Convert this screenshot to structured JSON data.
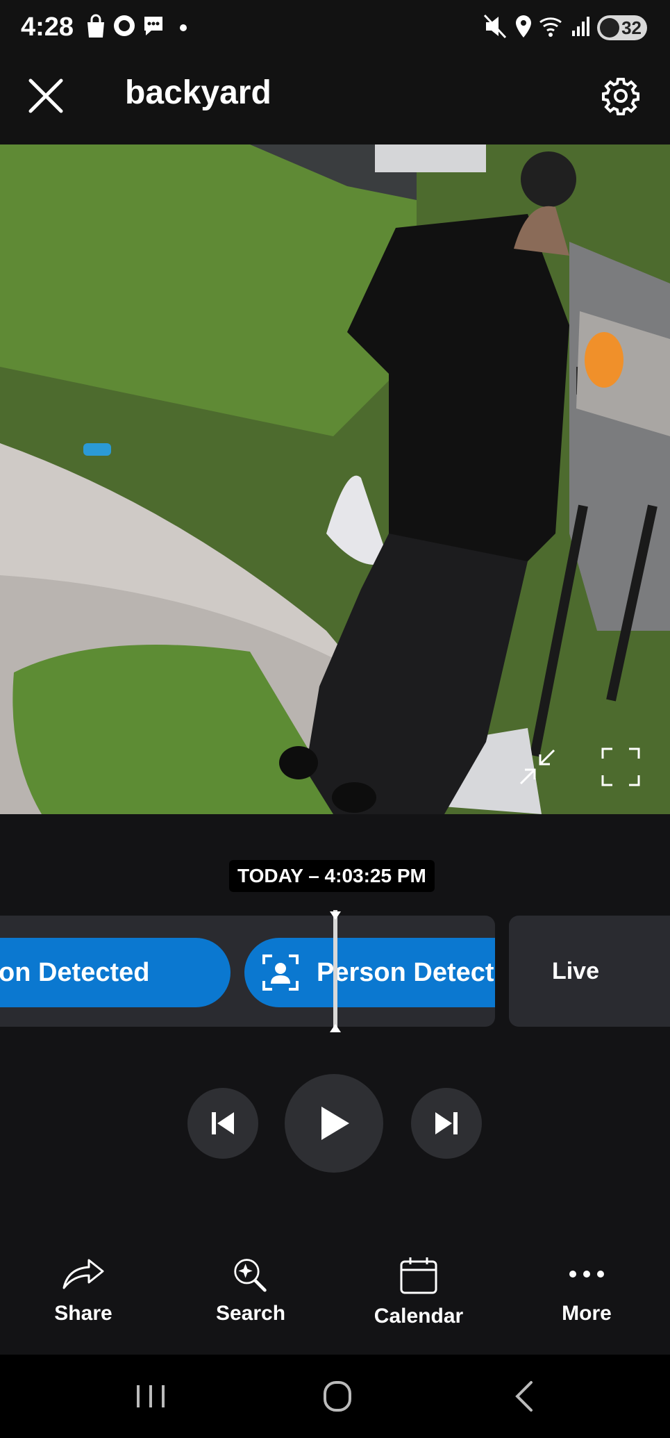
{
  "status_bar": {
    "time": "4:28",
    "battery": "32"
  },
  "header": {
    "title": "backyard"
  },
  "player": {
    "timestamp": "TODAY – 4:03:25 PM"
  },
  "timeline": {
    "events": [
      {
        "label": "on Detected"
      },
      {
        "label": "Person Detect"
      }
    ],
    "live_label": "Live"
  },
  "actions": [
    {
      "label": "Share",
      "icon": "share-icon"
    },
    {
      "label": "Search",
      "icon": "search-icon"
    },
    {
      "label": "Calendar",
      "icon": "calendar-icon"
    },
    {
      "label": "More",
      "icon": "more-icon"
    }
  ],
  "colors": {
    "accent": "#0b78d0",
    "background": "#131315",
    "panel": "#2a2b30"
  }
}
